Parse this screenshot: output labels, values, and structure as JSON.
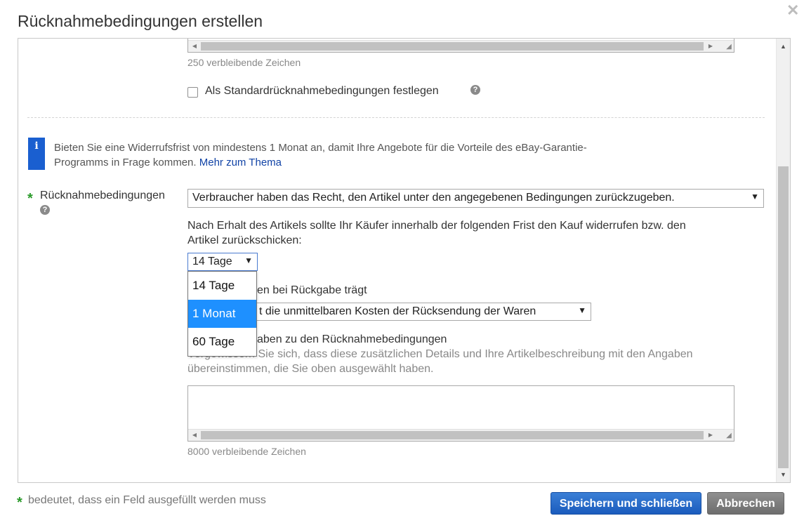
{
  "dialog": {
    "title": "Rücknahmebedingungen erstellen",
    "close_glyph": "✕"
  },
  "top_textarea": {
    "remaining": "250 verbleibende Zeichen"
  },
  "default_checkbox": {
    "label": "Als Standardrücknahmebedingungen festlegen",
    "checked": false
  },
  "info": {
    "icon": "i",
    "text": "Bieten Sie eine Widerrufsfrist von mindestens 1 Monat an, damit Ihre Angebote für die Vorteile des eBay-Garantie-",
    "text2": "Programms in Frage kommen.",
    "link": "Mehr zum Thema"
  },
  "returns": {
    "label": "Rücknahmebedingungen",
    "required_star": "*",
    "policy_select": "Verbraucher haben das Recht, den Artikel unter den angegebenen Bedingungen zurückzugeben.",
    "period_text": "Nach Erhalt des Artikels sollte Ihr Käufer innerhalb der folgenden Frist den Kauf widerrufen bzw. den",
    "period_text2": "Artikel zurückschicken:",
    "period_select": "14 Tage",
    "period_options": [
      "14 Tage",
      "1 Monat",
      "60 Tage"
    ],
    "period_highlighted": "1 Monat",
    "cost_label_visible": "en bei Rückgabe trägt",
    "cost_select_visible": "t die unmittelbaren Kosten der Rücksendung der Waren",
    "details_label_visible": "aben zu den Rücknahmebedingungen",
    "details_hint_visible": "Vergewissern Sie sich, dass diese zusätzlichen Details und Ihre Artikelbeschreibung mit den Angaben",
    "details_hint2": "übereinstimmen, die Sie oben ausgewählt haben.",
    "details_remaining": "8000 verbleibende Zeichen"
  },
  "footer": {
    "required_star": "*",
    "required_note": "bedeutet, dass ein Feld ausgefüllt werden muss",
    "save_button": "Speichern und schließen",
    "cancel_button": "Abbrechen"
  },
  "colors": {
    "primary_button": "#1a5bbd",
    "cancel_button": "#6d6d6d",
    "info_icon": "#1a5fd0",
    "link": "#1143a6",
    "highlight": "#1e90ff",
    "required_star": "#2a9a2a"
  }
}
